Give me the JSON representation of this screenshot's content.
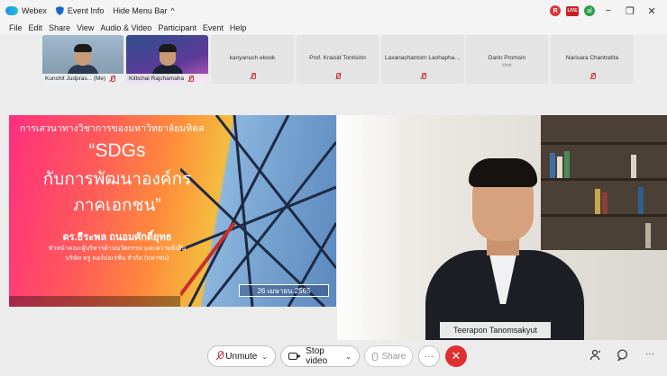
{
  "titlebar": {
    "app_name": "Webex",
    "event_info": "Event Info",
    "hide_menu": "Hide Menu Bar",
    "hide_menu_chevron": "^",
    "rec_letter": "R",
    "live_label": "LIVE",
    "signal_letter": "al",
    "minimize": "−",
    "restore": "❐",
    "close": "✕"
  },
  "menu": [
    "File",
    "Edit",
    "Share",
    "View",
    "Audio & Video",
    "Participant",
    "Event",
    "Help"
  ],
  "participants": {
    "video": [
      {
        "name": "Kunchit Judpras... (Me)"
      },
      {
        "name": "Kittichai Rajchamaha"
      }
    ],
    "tiles": [
      {
        "name": "kanyanuch ekook",
        "role": ""
      },
      {
        "name": "Prof. Kraisid Tontisirin",
        "role": ""
      },
      {
        "name": "Laxanachantorn Laohaphan...",
        "role": ""
      },
      {
        "name": "Darin Promsin",
        "role": "Host"
      },
      {
        "name": "Narisara Chantratita",
        "role": ""
      }
    ]
  },
  "slide": {
    "heading": "การเสวนาทางวิชาการของมหาวิทยาลัยมหิดล",
    "quote_line1": "“SDGs",
    "quote_line2": "กับการพัฒนาองค์กร",
    "quote_line3": "ภาคเอกชน”",
    "speaker": "ดร.ธีระพล ถนอมศักดิ์ยุทธ",
    "position_line1": "หัวหน้าคณะผู้บริหารด้านนวัตกรรม และความยั่งยืน",
    "position_line2": "บริษัท ทรู คอร์ปอเรชั่น จำกัด (มหาชน)",
    "date": "26 เมษายน 2565"
  },
  "speaker_video": {
    "name": "Teerapon Tanomsakyut"
  },
  "controls": {
    "unmute": "Unmute",
    "stop_video": "Stop video",
    "share": "Share",
    "more": "···",
    "leave_icon": "✕",
    "participants_icon": "participants-icon",
    "chat_icon": "chat-icon",
    "overflow": "···"
  }
}
